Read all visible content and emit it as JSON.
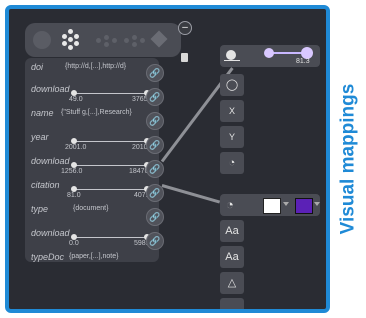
{
  "side_title": "Visual mappings",
  "fields": [
    {
      "name": "doi",
      "value": "{http://d,[...],http://d}"
    },
    {
      "name": "download",
      "min": "49.0",
      "max": "3765.0"
    },
    {
      "name": "name",
      "value": "{\"Stuff g,[...],Research}"
    },
    {
      "name": "year",
      "min": "2001.0",
      "max": "2010.0"
    },
    {
      "name": "download",
      "min": "1256.0",
      "max": "18470.0"
    },
    {
      "name": "citation",
      "min": "81.0",
      "max": "407.0"
    },
    {
      "name": "type",
      "value": "{document}"
    },
    {
      "name": "download",
      "min": "0.0",
      "max": "598.0"
    },
    {
      "name": "typeDoc",
      "value": "{paper,[...],note}"
    }
  ],
  "size_mapping": {
    "value": "81.3"
  },
  "tools": {
    "x_label": "X",
    "y_label": "Y",
    "text_label": "Aa",
    "text_label2": "Aa"
  },
  "colors": {
    "accent": "#1f8ad6",
    "swatch_start": "#ffffff",
    "swatch_end": "#5b21b6"
  },
  "icons": {
    "link": "chain-link-icon",
    "close": "close-icon",
    "lock": "lock-icon"
  }
}
